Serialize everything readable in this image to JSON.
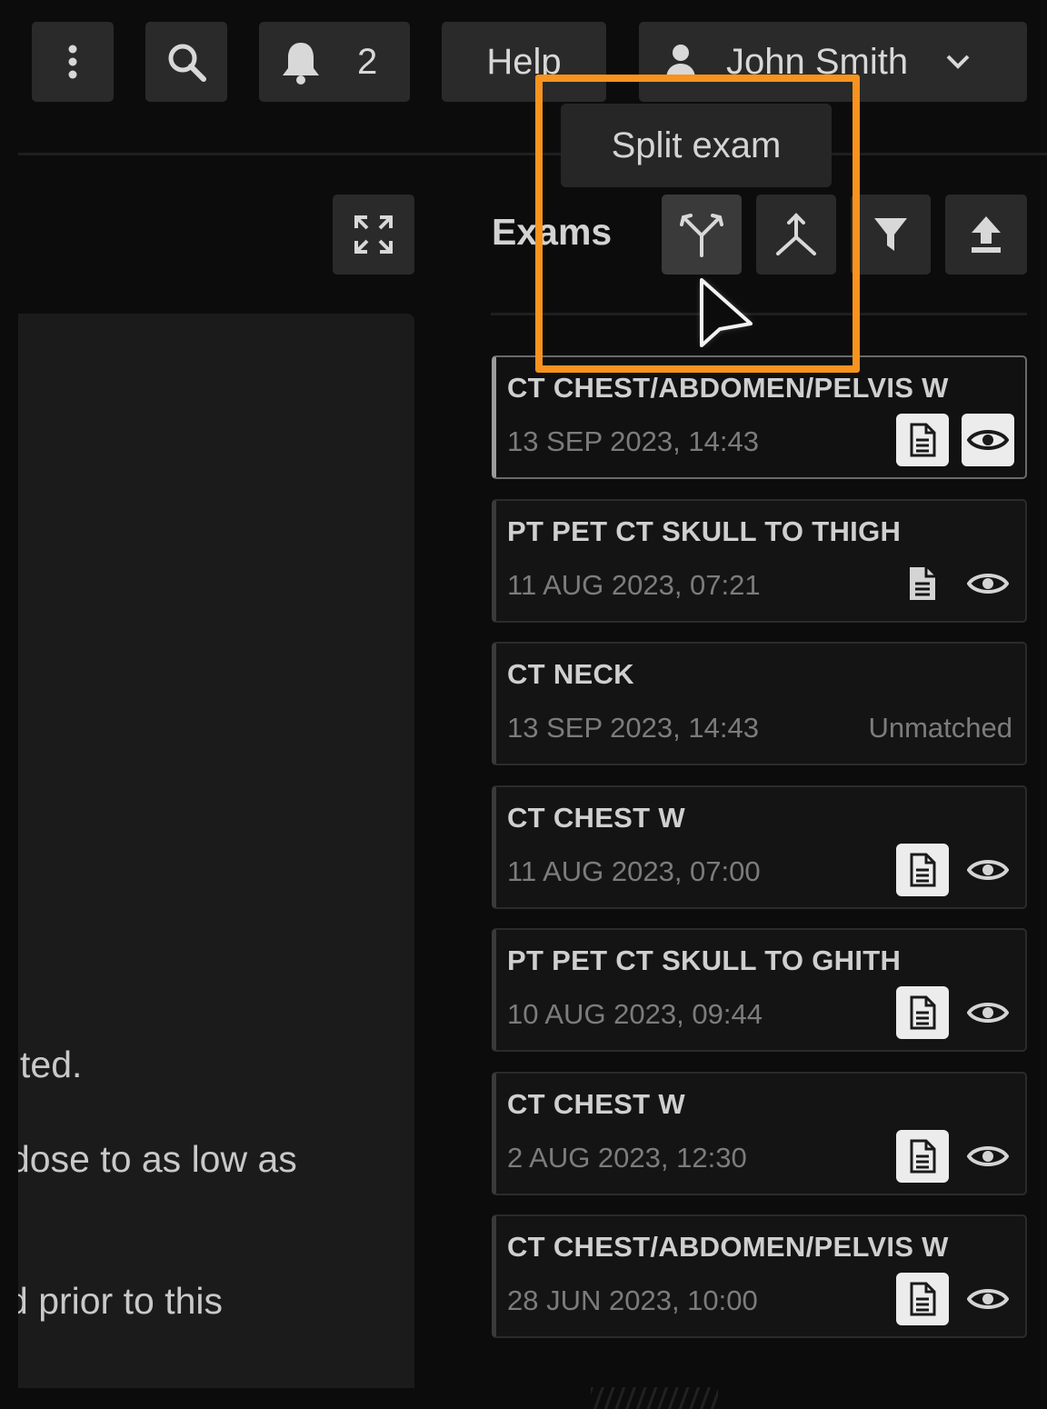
{
  "header": {
    "notifications_count": "2",
    "help_label": "Help",
    "user_name": "John Smith"
  },
  "tooltip": {
    "text": "Split exam"
  },
  "left_panel": {
    "lines": [
      "ted.",
      "dose to as low as",
      "d prior to this"
    ]
  },
  "exams": {
    "title": "Exams",
    "items": [
      {
        "title": "CT CHEST/ABDOMEN/PELVIS W",
        "date": "13 SEP 2023, 14:43",
        "status": "",
        "selected": true
      },
      {
        "title": "PT PET CT SKULL TO THIGH",
        "date": "11 AUG 2023, 07:21",
        "status": ""
      },
      {
        "title": "CT NECK",
        "date": "13 SEP 2023, 14:43",
        "status": "Unmatched"
      },
      {
        "title": "CT CHEST W",
        "date": "11 AUG 2023, 07:00",
        "status": ""
      },
      {
        "title": "PT PET CT SKULL TO GHITH",
        "date": "10 AUG 2023, 09:44",
        "status": ""
      },
      {
        "title": "CT CHEST W",
        "date": "2 AUG 2023, 12:30",
        "status": ""
      },
      {
        "title": "CT CHEST/ABDOMEN/PELVIS W",
        "date": "28 JUN 2023, 10:00",
        "status": ""
      }
    ]
  },
  "icons": {
    "menu": "more-vertical-icon",
    "search": "search-icon",
    "notifications": "bell-icon",
    "user": "user-icon",
    "dropdown": "chevron-down-icon",
    "expand": "expand-icon",
    "split": "split-icon",
    "merge": "merge-icon",
    "filter": "filter-icon",
    "upload": "upload-icon",
    "report": "document-icon",
    "view": "eye-icon"
  },
  "colors": {
    "highlight": "#f7931e",
    "background": "#0c0c0c"
  }
}
